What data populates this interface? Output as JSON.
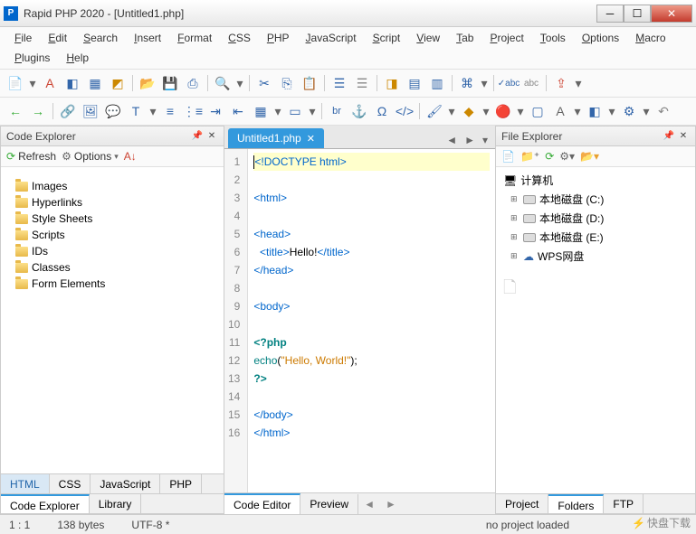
{
  "window": {
    "title": "Rapid PHP 2020 - [Untitled1.php]",
    "icon_letter": "P"
  },
  "menu": [
    "File",
    "Edit",
    "Search",
    "Insert",
    "Format",
    "CSS",
    "PHP",
    "JavaScript",
    "Script",
    "View",
    "Tab",
    "Project",
    "Tools",
    "Options",
    "Macro",
    "Plugins",
    "Help"
  ],
  "code_explorer": {
    "title": "Code Explorer",
    "refresh": "Refresh",
    "options": "Options",
    "items": [
      "Images",
      "Hyperlinks",
      "Style Sheets",
      "Scripts",
      "IDs",
      "Classes",
      "Form Elements"
    ],
    "lang_tabs": [
      "HTML",
      "CSS",
      "JavaScript",
      "PHP"
    ],
    "panel_tabs": [
      "Code Explorer",
      "Library"
    ]
  },
  "editor": {
    "tab_name": "Untitled1.php",
    "lines": [
      {
        "n": 1,
        "html": "<span class='tag'>&lt;!DOCTYPE html&gt;</span>",
        "hl": true
      },
      {
        "n": 2,
        "html": ""
      },
      {
        "n": 3,
        "html": "<span class='tag'>&lt;html&gt;</span>"
      },
      {
        "n": 4,
        "html": ""
      },
      {
        "n": 5,
        "html": "<span class='tag'>&lt;head&gt;</span>"
      },
      {
        "n": 6,
        "html": "  <span class='tag'>&lt;title&gt;</span>Hello!<span class='tag'>&lt;/title&gt;</span>"
      },
      {
        "n": 7,
        "html": "<span class='tag'>&lt;/head&gt;</span>"
      },
      {
        "n": 8,
        "html": ""
      },
      {
        "n": 9,
        "html": "<span class='tag'>&lt;body&gt;</span>"
      },
      {
        "n": 10,
        "html": ""
      },
      {
        "n": 11,
        "html": "<span class='php'>&lt;?php</span>"
      },
      {
        "n": 12,
        "html": "<span class='fn'>echo</span>(<span class='str'>\"Hello, World!\"</span>);"
      },
      {
        "n": 13,
        "html": "<span class='php'>?&gt;</span>"
      },
      {
        "n": 14,
        "html": ""
      },
      {
        "n": 15,
        "html": "<span class='tag'>&lt;/body&gt;</span>"
      },
      {
        "n": 16,
        "html": "<span class='tag'>&lt;/html&gt;</span>"
      }
    ],
    "bottom_tabs": [
      "Code Editor",
      "Preview"
    ]
  },
  "file_explorer": {
    "title": "File Explorer",
    "root": "计算机",
    "drives": [
      "本地磁盘 (C:)",
      "本地磁盘 (D:)",
      "本地磁盘 (E:)",
      "WPS网盘"
    ],
    "panel_tabs": [
      "Project",
      "Folders",
      "FTP"
    ]
  },
  "status": {
    "pos": "1 : 1",
    "size": "138 bytes",
    "enc": "UTF-8 *",
    "proj": "no project loaded"
  },
  "watermark": "快盘下载"
}
